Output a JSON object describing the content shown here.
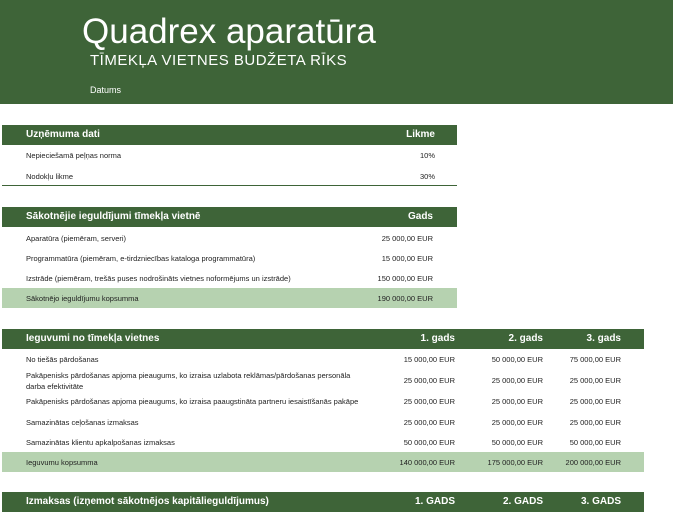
{
  "header": {
    "title": "Quadrex aparatūra",
    "subtitle": "TĪMEKĻA VIETNES BUDŽETA RĪKS",
    "date_label": "Datums"
  },
  "company": {
    "heading": "Uzņēmuma dati",
    "column": "Likme",
    "rows": [
      {
        "label": "Nepieciešamā peļņas norma",
        "value": "10%"
      },
      {
        "label": "Nodokļu likme",
        "value": "30%"
      }
    ]
  },
  "initial": {
    "heading": "Sākotnējie ieguldījumi tīmekļa vietnē",
    "column": "Gads",
    "rows": [
      {
        "label": "Aparatūra (piemēram, serveri)",
        "value": "25 000,00 EUR"
      },
      {
        "label": "Programmatūra (piemēram, e-tirdzniecības kataloga programmatūra)",
        "value": "15 000,00 EUR"
      },
      {
        "label": "Izstrāde (piemēram, trešās puses nodrošināts vietnes noformējums un izstrāde)",
        "value": "150 000,00 EUR"
      }
    ],
    "total": {
      "label": "Sākotnējo ieguldījumu kopsumma",
      "value": "190 000,00 EUR"
    }
  },
  "benefits": {
    "heading": "Ieguvumi no tīmekļa vietnes",
    "columns": [
      "1. gads",
      "2. gads",
      "3. gads"
    ],
    "rows": [
      {
        "label": "No tiešās pārdošanas",
        "values": [
          "15 000,00 EUR",
          "50 000,00 EUR",
          "75 000,00 EUR"
        ]
      },
      {
        "label": "Pakāpenisks pārdošanas apjoma pieaugums, ko izraisa uzlabota reklāmas/pārdošanas personāla darba efektivitāte",
        "values": [
          "25 000,00 EUR",
          "25 000,00 EUR",
          "25 000,00 EUR"
        ]
      },
      {
        "label": "Pakāpenisks pārdošanas apjoma pieaugums, ko izraisa paaugstināta partneru iesaistīšanās pakāpe",
        "values": [
          "25 000,00 EUR",
          "25 000,00 EUR",
          "25 000,00 EUR"
        ]
      },
      {
        "label": "Samazinātas ceļošanas izmaksas",
        "values": [
          "25 000,00 EUR",
          "25 000,00 EUR",
          "25 000,00 EUR"
        ]
      },
      {
        "label": "Samazinātas klientu apkalpošanas izmaksas",
        "values": [
          "50 000,00 EUR",
          "50 000,00 EUR",
          "50 000,00 EUR"
        ]
      }
    ],
    "total": {
      "label": "Ieguvumu kopsumma",
      "values": [
        "140 000,00 EUR",
        "175 000,00 EUR",
        "200 000,00 EUR"
      ]
    }
  },
  "costs": {
    "heading": "Izmaksas (izņemot sākotnējos kapitālieguldījumus)",
    "columns": [
      "1. GADS",
      "2. GADS",
      "3. GADS"
    ]
  }
}
